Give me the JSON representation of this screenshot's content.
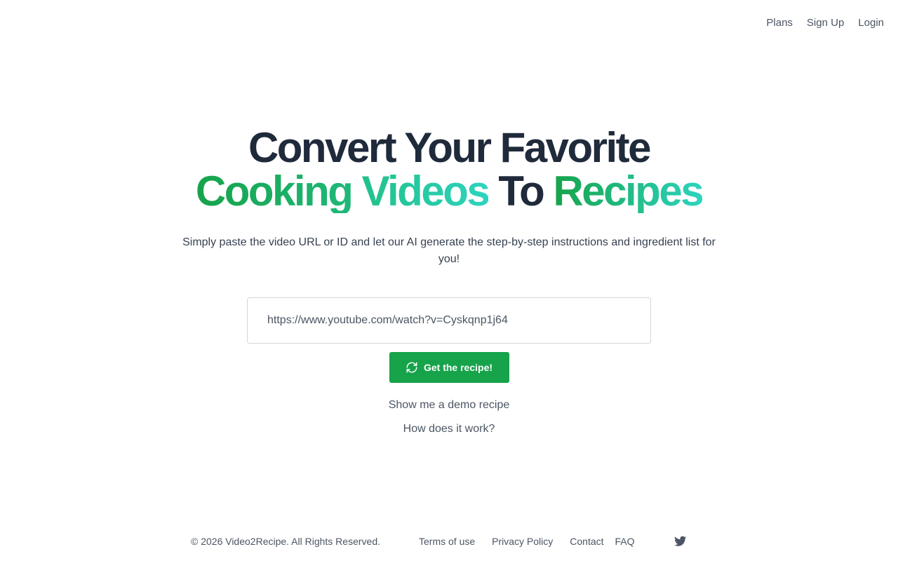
{
  "nav": {
    "plans": "Plans",
    "signup": "Sign Up",
    "login": "Login"
  },
  "hero": {
    "line1": "Convert Your Favorite",
    "word_cooking": "Cooking",
    "word_videos": "Videos",
    "word_to": "To",
    "word_recipes": "Recipes",
    "subtitle": "Simply paste the video URL or ID and let our AI generate the step-by-step instructions and ingredient list for you!"
  },
  "form": {
    "url_value": "https://www.youtube.com/watch?v=Cyskqnp1j64",
    "submit_label": "Get the recipe!",
    "submit_icon": "refresh-icon"
  },
  "links": {
    "demo": "Show me a demo recipe",
    "how": "How does it work?"
  },
  "footer": {
    "copyright": "© 2026 Video2Recipe. All Rights Reserved.",
    "terms": "Terms of use",
    "privacy": "Privacy Policy",
    "contact": "Contact",
    "faq": "FAQ",
    "social_icon": "twitter-icon"
  },
  "colors": {
    "accent": "#16a34a",
    "gradient_end": "#2dd4bf",
    "heading": "#1f2a3b"
  }
}
